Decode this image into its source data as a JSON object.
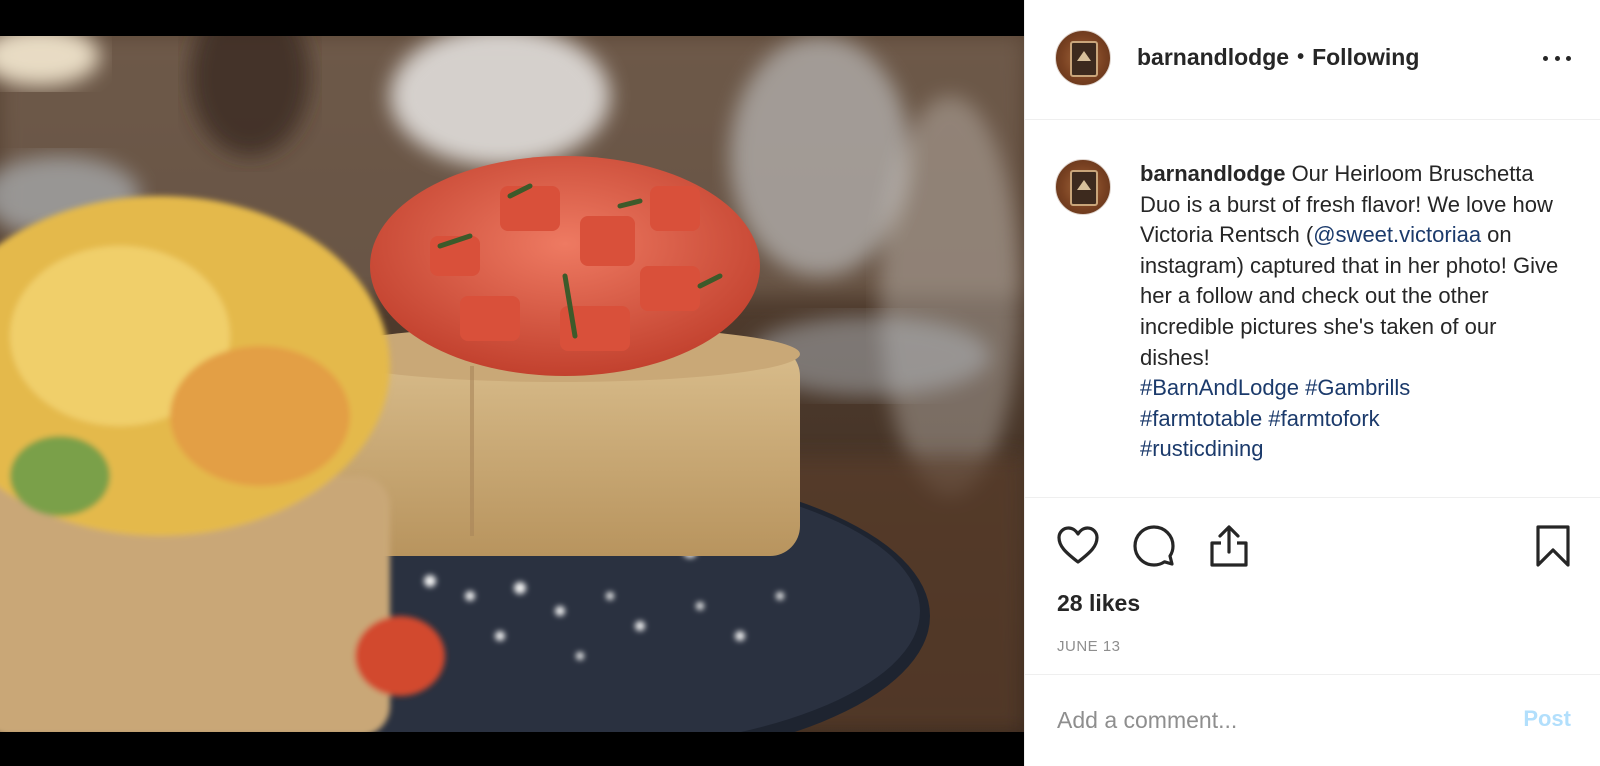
{
  "post": {
    "image_alt": "Heirloom Bruschetta Duo on a dark plate"
  },
  "header": {
    "username": "barnandlodge",
    "separator": "•",
    "follow_status": "Following"
  },
  "caption": {
    "username": "barnandlodge",
    "text_before_mention": " Our Heirloom Bruschetta Duo is a burst of fresh flavor! We love how Victoria Rentsch (",
    "mention": "@sweet.victoriaa",
    "text_after_mention": " on instagram) captured that in her photo! Give her a follow and check out the other incredible pictures she's taken of our dishes!",
    "hashtags": [
      "#BarnAndLodge",
      "#Gambrills",
      "#farmtotable",
      "#farmtofork",
      "#rusticdining"
    ]
  },
  "stats": {
    "likes": "28 likes",
    "date": "JUNE 13"
  },
  "comment": {
    "placeholder": "Add a comment...",
    "post_label": "Post"
  },
  "icons": {
    "like": "heart-icon",
    "comment": "comment-icon",
    "share": "share-icon",
    "save": "bookmark-icon",
    "more": "more-options-icon"
  },
  "colors": {
    "link": "#1b3a6b",
    "text": "#262626",
    "muted": "#8e8e8e",
    "post_disabled": "#b2dffc"
  }
}
